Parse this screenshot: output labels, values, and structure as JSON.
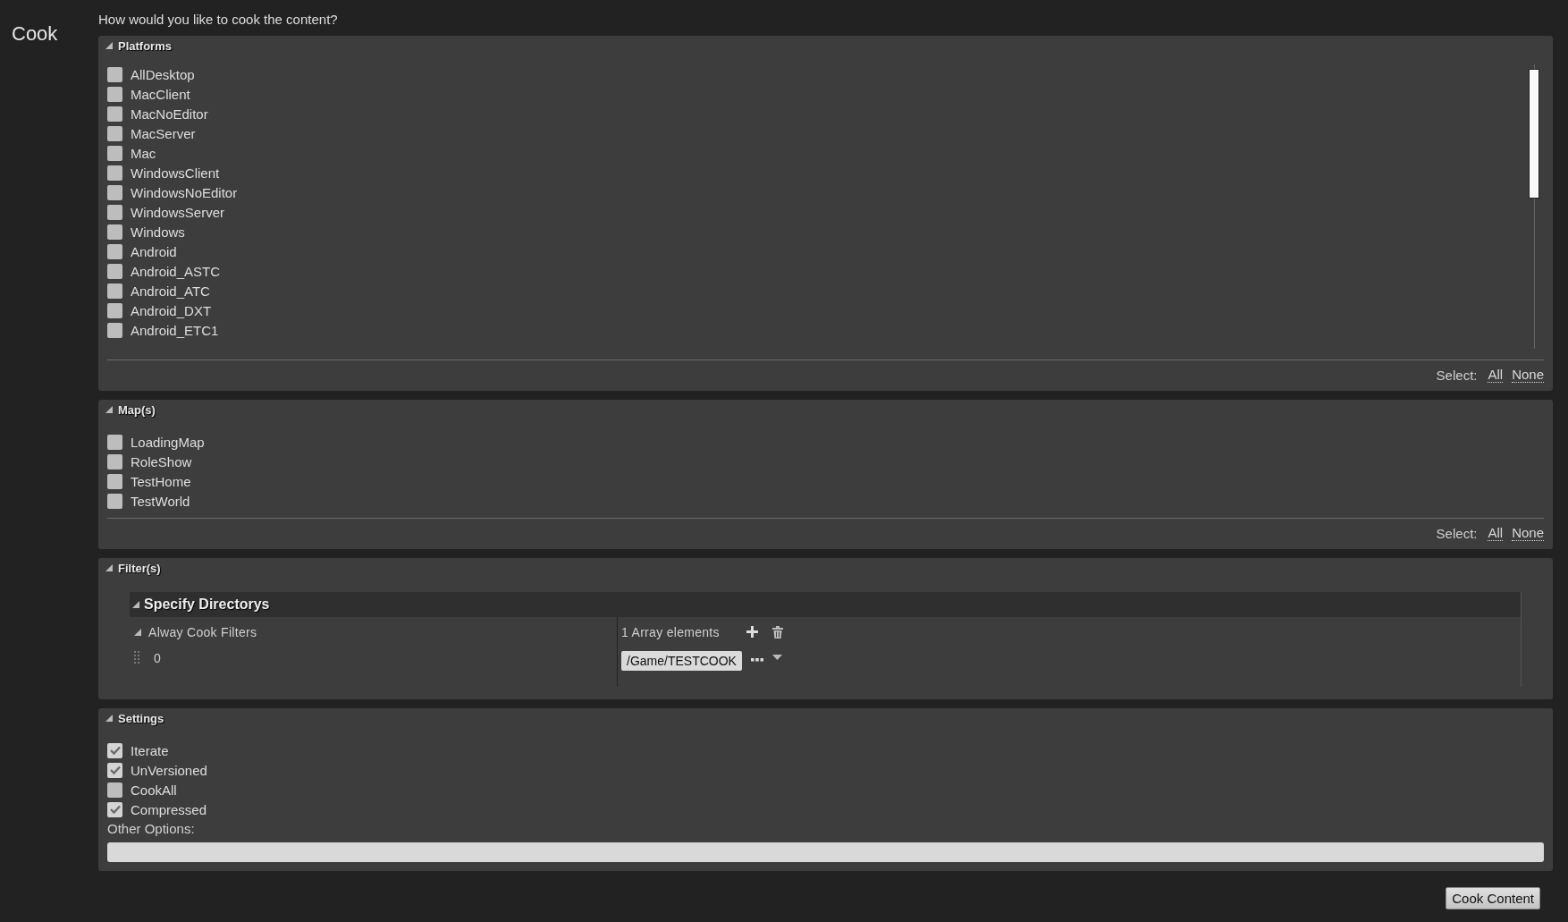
{
  "window": {
    "title": "Cook"
  },
  "prompt": "How would you like to cook the content?",
  "sections": [
    {
      "kind": "checklist",
      "title": "Platforms",
      "expanded": true,
      "scrollable": true,
      "items": [
        {
          "label": "AllDesktop",
          "checked": false
        },
        {
          "label": "MacClient",
          "checked": false
        },
        {
          "label": "MacNoEditor",
          "checked": false
        },
        {
          "label": "MacServer",
          "checked": false
        },
        {
          "label": "Mac",
          "checked": false
        },
        {
          "label": "WindowsClient",
          "checked": false
        },
        {
          "label": "WindowsNoEditor",
          "checked": false
        },
        {
          "label": "WindowsServer",
          "checked": false
        },
        {
          "label": "Windows",
          "checked": false
        },
        {
          "label": "Android",
          "checked": false
        },
        {
          "label": "Android_ASTC",
          "checked": false
        },
        {
          "label": "Android_ATC",
          "checked": false
        },
        {
          "label": "Android_DXT",
          "checked": false
        },
        {
          "label": "Android_ETC1",
          "checked": false
        }
      ],
      "select_label": "Select:",
      "select_links": [
        "All",
        "None"
      ]
    },
    {
      "kind": "checklist",
      "title": "Map(s)",
      "expanded": true,
      "scrollable": false,
      "items": [
        {
          "label": "LoadingMap",
          "checked": false
        },
        {
          "label": "RoleShow",
          "checked": false
        },
        {
          "label": "TestHome",
          "checked": false
        },
        {
          "label": "TestWorld",
          "checked": false
        }
      ],
      "select_label": "Select:",
      "select_links": [
        "All",
        "None"
      ]
    },
    {
      "kind": "filters",
      "title": "Filter(s)",
      "expanded": true,
      "group": {
        "title": "Specify Directorys",
        "expanded": true,
        "property": {
          "label": "Alway Cook Filters",
          "expanded": true,
          "value": "1 Array elements"
        },
        "elements": [
          {
            "index": "0",
            "value": "/Game/TESTCOOK"
          }
        ]
      }
    },
    {
      "kind": "settings",
      "title": "Settings",
      "expanded": true,
      "items": [
        {
          "label": "Iterate",
          "checked": true
        },
        {
          "label": "UnVersioned",
          "checked": true
        },
        {
          "label": "CookAll",
          "checked": false
        },
        {
          "label": "Compressed",
          "checked": true
        }
      ],
      "field_label": "Other Options:"
    }
  ],
  "action_button": "Cook Content"
}
